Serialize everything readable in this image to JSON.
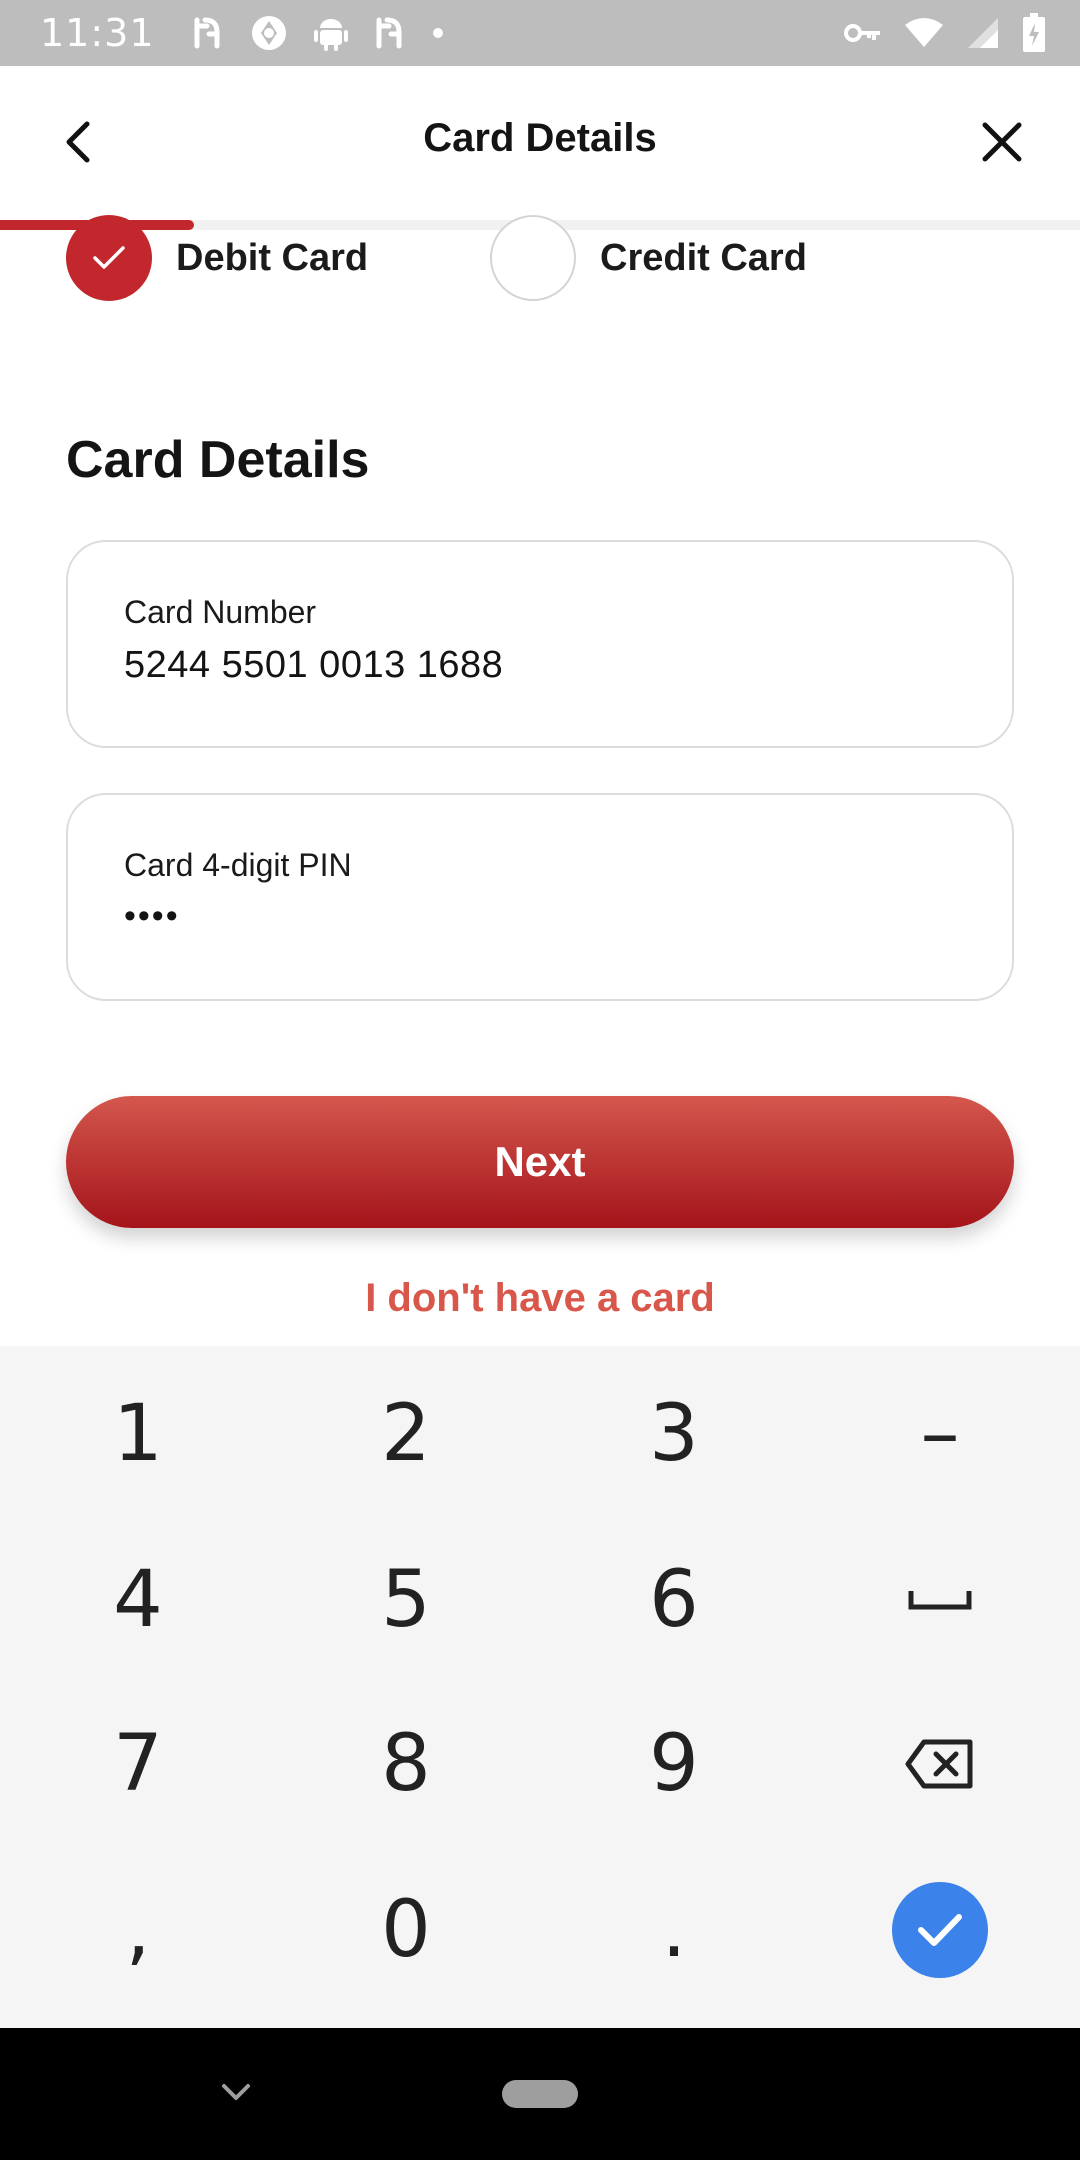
{
  "status_bar": {
    "time": "11:31",
    "left_icons": [
      "food-app-icon",
      "camera-shutter-icon",
      "android-icon",
      "food-app-icon",
      "dot-icon"
    ],
    "right_icons": [
      "vpn-key-icon",
      "wifi-icon",
      "cell-signal-icon",
      "battery-charging-icon"
    ]
  },
  "header": {
    "title": "Card Details",
    "progress": 0.18,
    "accent_color": "#c1272d"
  },
  "card_type": {
    "options": [
      {
        "label": "Debit Card",
        "selected": true
      },
      {
        "label": "Credit Card",
        "selected": false
      }
    ]
  },
  "form": {
    "section_title": "Card Details",
    "card_number": {
      "label": "Card Number",
      "value": "5244 5501 0013 1688"
    },
    "pin": {
      "label": "Card 4-digit PIN",
      "value": "••••"
    }
  },
  "actions": {
    "next_label": "Next",
    "no_card_label": "I don't have a card"
  },
  "keyboard": {
    "keys": [
      [
        "1",
        "2",
        "3",
        "–"
      ],
      [
        "4",
        "5",
        "6",
        "space-icon"
      ],
      [
        "7",
        "8",
        "9",
        "backspace-icon"
      ],
      [
        ",",
        "0",
        ".",
        "done-check-icon"
      ]
    ],
    "done_color": "#3b82ea"
  }
}
